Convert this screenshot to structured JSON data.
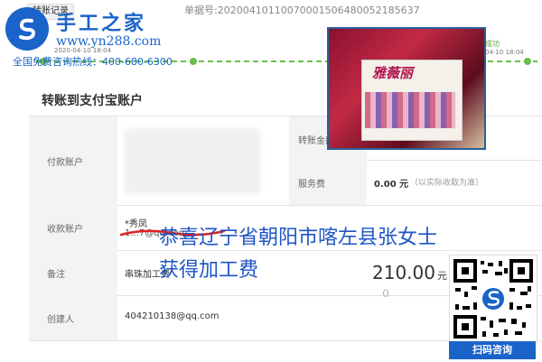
{
  "top": {
    "tab": "转账记录",
    "receipt": "单据号:20200410110070001506480052185637"
  },
  "logo": {
    "title": "手工之家",
    "url": "www.yn288.com",
    "hotline": "全国免费咨询热线：400-680-6300"
  },
  "timeline": {
    "date_left": "2020-04-10 18:04",
    "date_right": "04-10 18:04",
    "status_right": "成功"
  },
  "section_title": "转账到支付宝账户",
  "rows": {
    "payer": {
      "label": "付款账户"
    },
    "amount": {
      "label": "转账金额"
    },
    "fee": {
      "label": "服务费",
      "value": "0.00 元",
      "note": "（以实际收取为准）"
    },
    "payee": {
      "label": "收款账户",
      "name": "*秀凤",
      "account": "1...7@qq.com"
    },
    "remark": {
      "label": "备注",
      "value": "串珠加工费"
    },
    "creator": {
      "label": "创建人",
      "value": "404210138@qq.com"
    }
  },
  "amount_display": {
    "value": "210.00",
    "unit": "元",
    "paren": "（）"
  },
  "headline": {
    "line1": "恭喜辽宁省朝阳市喀左县张女士",
    "line2": "获得加工费"
  },
  "photo": {
    "brand": "雅薇丽"
  },
  "qr": {
    "label": "扫码咨询"
  },
  "colors": {
    "brand_blue": "#1a63c9",
    "timeline_green": "#66c04a",
    "headline_blue": "#1f55c4"
  }
}
